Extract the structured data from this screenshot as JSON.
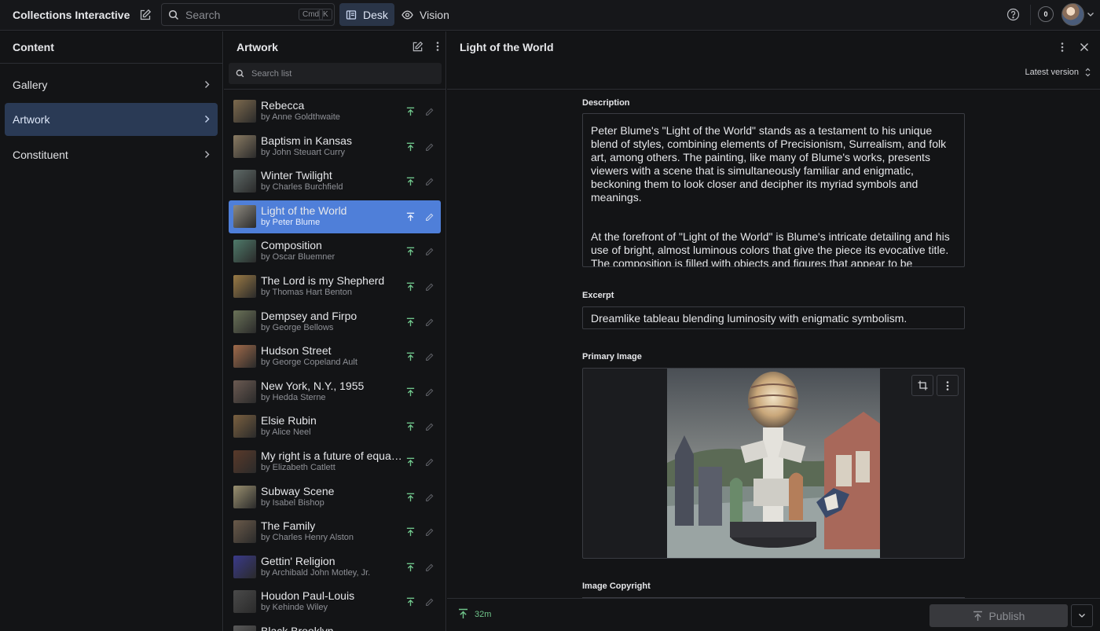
{
  "app": {
    "title": "Collections Interactive",
    "search_placeholder": "Search",
    "search_shortcut": [
      "Cmd",
      "K"
    ],
    "tools": [
      {
        "label": "Desk",
        "icon": "desk-icon",
        "active": true
      },
      {
        "label": "Vision",
        "icon": "eye-icon",
        "active": false
      }
    ],
    "notification_count": "0"
  },
  "content_pane": {
    "title": "Content",
    "items": [
      {
        "label": "Gallery",
        "active": false
      },
      {
        "label": "Artwork",
        "active": true
      },
      {
        "label": "Constituent",
        "active": false
      }
    ]
  },
  "artwork_pane": {
    "title": "Artwork",
    "search_placeholder": "Search list",
    "rows": [
      {
        "title": "Rebecca",
        "by": "by Anne Goldthwaite",
        "thumb": "#7d6a4e"
      },
      {
        "title": "Baptism in Kansas",
        "by": "by John Steuart Curry",
        "thumb": "#8a7b63"
      },
      {
        "title": "Winter Twilight",
        "by": "by Charles Burchfield",
        "thumb": "#5f6a68"
      },
      {
        "title": "Light of the World",
        "by": "by Peter Blume",
        "thumb": "#8e8a80",
        "selected": true
      },
      {
        "title": "Composition",
        "by": "by Oscar Bluemner",
        "thumb": "#4f7a6a"
      },
      {
        "title": "The Lord is my Shepherd",
        "by": "by Thomas Hart Benton",
        "thumb": "#9a7a45"
      },
      {
        "title": "Dempsey and Firpo",
        "by": "by George Bellows",
        "thumb": "#6a7258"
      },
      {
        "title": "Hudson Street",
        "by": "by George Copeland Ault",
        "thumb": "#a06a4a"
      },
      {
        "title": "New York, N.Y., 1955",
        "by": "by Hedda Sterne",
        "thumb": "#6b5a52"
      },
      {
        "title": "Elsie Rubin",
        "by": "by Alice Neel",
        "thumb": "#7a6040"
      },
      {
        "title": "My right is a future of equality with other Americans",
        "by": "by Elizabeth Catlett",
        "thumb": "#5a3a2a"
      },
      {
        "title": "Subway Scene",
        "by": "by Isabel Bishop",
        "thumb": "#9a9070"
      },
      {
        "title": "The Family",
        "by": "by Charles Henry Alston",
        "thumb": "#6a5a4a"
      },
      {
        "title": "Gettin' Religion",
        "by": "by Archibald John Motley, Jr.",
        "thumb": "#3a3a8a"
      },
      {
        "title": "Houdon Paul-Louis",
        "by": "by Kehinde Wiley",
        "thumb": "#4a4a4a"
      },
      {
        "title": "Black Brooklyn",
        "by": "",
        "thumb": "#5a5a5a"
      }
    ]
  },
  "document": {
    "title": "Light of the World",
    "version_label": "Latest version",
    "description_label": "Description",
    "description_paragraphs": [
      "Peter Blume's \"Light of the World\" stands as a testament to his unique blend of styles, combining elements of Precisionism, Surrealism, and folk art, among others. The painting, like many of Blume's works, presents viewers with a scene that is simultaneously familiar and enigmatic, beckoning them to look closer and decipher its myriad symbols and meanings.",
      "At the forefront of \"Light of the World\" is Blume's intricate detailing and his use of bright, almost luminous colors that give the piece its evocative title. The composition is filled with objects and figures that appear to be"
    ],
    "excerpt_label": "Excerpt",
    "excerpt_value": "Dreamlike tableau blending luminosity with enigmatic symbolism.",
    "primary_image_label": "Primary Image",
    "image_copyright_label": "Image Copyright"
  },
  "footer": {
    "last_published": "32m",
    "publish_label": "Publish"
  },
  "colors": {
    "accent": "#4f7fd9",
    "publish_green": "#6fc48a",
    "background": "#131416"
  }
}
